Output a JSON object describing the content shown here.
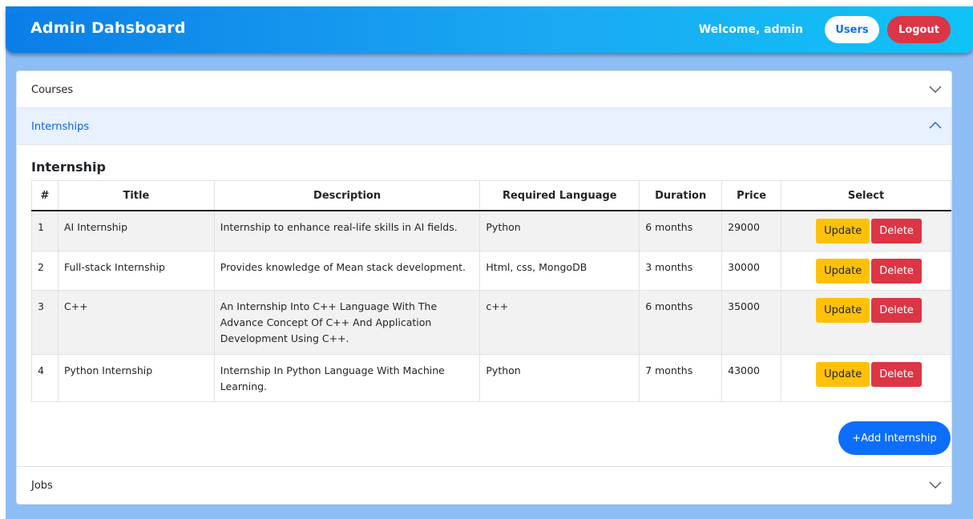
{
  "navbar": {
    "brand": "Admin Dahsboard",
    "welcome": "Welcome, admin",
    "users_label": "Users",
    "logout_label": "Logout"
  },
  "accordion": {
    "courses_label": "Courses",
    "internships_label": "Internships",
    "jobs_label": "Jobs"
  },
  "internship": {
    "title": "Internship",
    "columns": [
      "#",
      "Title",
      "Description",
      "Required Language",
      "Duration",
      "Price",
      "Select"
    ],
    "rows": [
      {
        "num": "1",
        "title": "AI Internship",
        "description": "Internship to enhance real-life skills in AI fields.",
        "language": "Python",
        "duration": "6 months",
        "price": "29000"
      },
      {
        "num": "2",
        "title": "Full-stack Internship",
        "description": "Provides knowledge of Mean stack development.",
        "language": "Html, css, MongoDB",
        "duration": "3 months",
        "price": "30000"
      },
      {
        "num": "3",
        "title": "C++",
        "description": "An Internship Into C++ Language With The Advance Concept Of C++ And Application Development Using C++.",
        "language": "c++",
        "duration": "6 months",
        "price": "35000"
      },
      {
        "num": "4",
        "title": "Python Internship",
        "description": "Internship In Python Language With Machine Learning.",
        "language": "Python",
        "duration": "7 months",
        "price": "43000"
      }
    ],
    "update_label": "Update",
    "delete_label": "Delete",
    "add_label": "+Add Internship"
  },
  "icons": {
    "courses": "chevron-down-icon",
    "internships": "chevron-up-icon",
    "jobs": "chevron-down-icon"
  },
  "colors": {
    "primary": "#0d6efd",
    "danger": "#dc3545",
    "warning": "#ffc107"
  }
}
